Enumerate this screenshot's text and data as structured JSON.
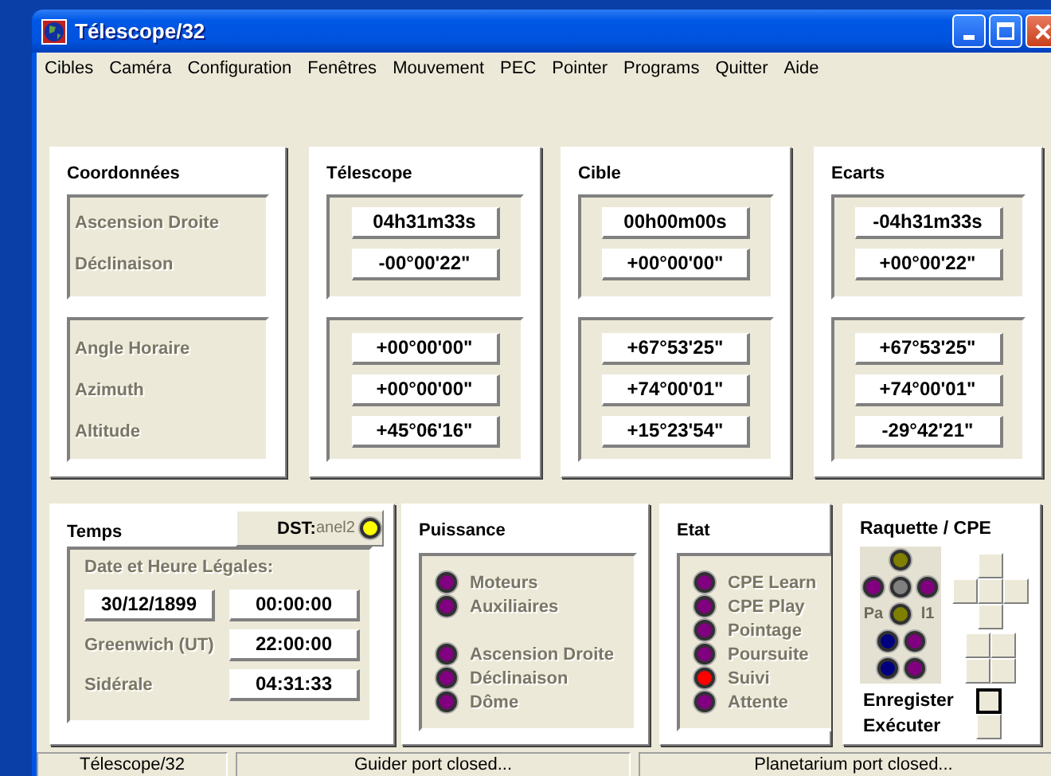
{
  "window": {
    "title": "Télescope/32"
  },
  "menu": [
    "Cibles",
    "Caméra",
    "Configuration",
    "Fenêtres",
    "Mouvement",
    "PEC",
    "Pointer",
    "Programs",
    "Quitter",
    "Aide"
  ],
  "panels": [
    {
      "title": "Coordonnées",
      "kind": "labels",
      "groups": [
        [
          "Ascension Droite",
          "Déclinaison"
        ],
        [
          "Angle Horaire",
          "Azimuth",
          "Altitude"
        ]
      ]
    },
    {
      "title": "Télescope",
      "kind": "values",
      "groups": [
        [
          "04h31m33s",
          "-00°00'22\""
        ],
        [
          "+00°00'00\"",
          "+00°00'00\"",
          "+45°06'16\""
        ]
      ]
    },
    {
      "title": "Cible",
      "kind": "values",
      "groups": [
        [
          "00h00m00s",
          "+00°00'00\""
        ],
        [
          "+67°53'25\"",
          "+74°00'01\"",
          "+15°23'54\""
        ]
      ]
    },
    {
      "title": "Ecarts",
      "kind": "values",
      "groups": [
        [
          "-04h31m33s",
          "+00°00'22\""
        ],
        [
          "+67°53'25\"",
          "+74°00'01\"",
          "-29°42'21\""
        ]
      ]
    }
  ],
  "temps": {
    "title": "Temps",
    "dst": {
      "label": "DST:",
      "caption": "anel2",
      "color": "#ffff00"
    },
    "heading": "Date et Heure Légales:",
    "date": "30/12/1899",
    "local_time": "00:00:00",
    "rows": [
      {
        "label": "Greenwich (UT)",
        "value": "22:00:00"
      },
      {
        "label": "Sidérale",
        "value": "04:31:33"
      }
    ]
  },
  "puissance": {
    "title": "Puissance",
    "groups": [
      [
        {
          "label": "Moteurs",
          "color": "#800080"
        },
        {
          "label": "Auxiliaires",
          "color": "#800080"
        }
      ],
      [
        {
          "label": "Ascension Droite",
          "color": "#800080"
        },
        {
          "label": "Déclinaison",
          "color": "#800080"
        },
        {
          "label": "Dôme",
          "color": "#800080"
        }
      ]
    ]
  },
  "etat": {
    "title": "Etat",
    "items": [
      {
        "label": "CPE Learn",
        "color": "#800080"
      },
      {
        "label": "CPE Play",
        "color": "#800080"
      },
      {
        "label": "Pointage",
        "color": "#800080"
      },
      {
        "label": "Poursuite",
        "color": "#800080"
      },
      {
        "label": "Suivi",
        "color": "#ff0000"
      },
      {
        "label": "Attente",
        "color": "#800080"
      }
    ]
  },
  "raquette": {
    "title": "Raquette / CPE",
    "caption_left": "Pa",
    "caption_right": "l1",
    "leds": [
      {
        "color": "#808000"
      },
      {
        "color": "#800080"
      },
      {
        "color": "#808080"
      },
      {
        "color": "#800080"
      },
      {
        "color": "#808000"
      },
      {
        "color": "#000080"
      },
      {
        "color": "#800080"
      },
      {
        "color": "#000080"
      },
      {
        "color": "#800080"
      }
    ],
    "actions": [
      {
        "label": "Enregister",
        "focused": true
      },
      {
        "label": "Exécuter",
        "focused": false
      }
    ]
  },
  "status_bar": [
    "Télescope/32",
    "Guider port closed...",
    "Planetarium port closed..."
  ]
}
